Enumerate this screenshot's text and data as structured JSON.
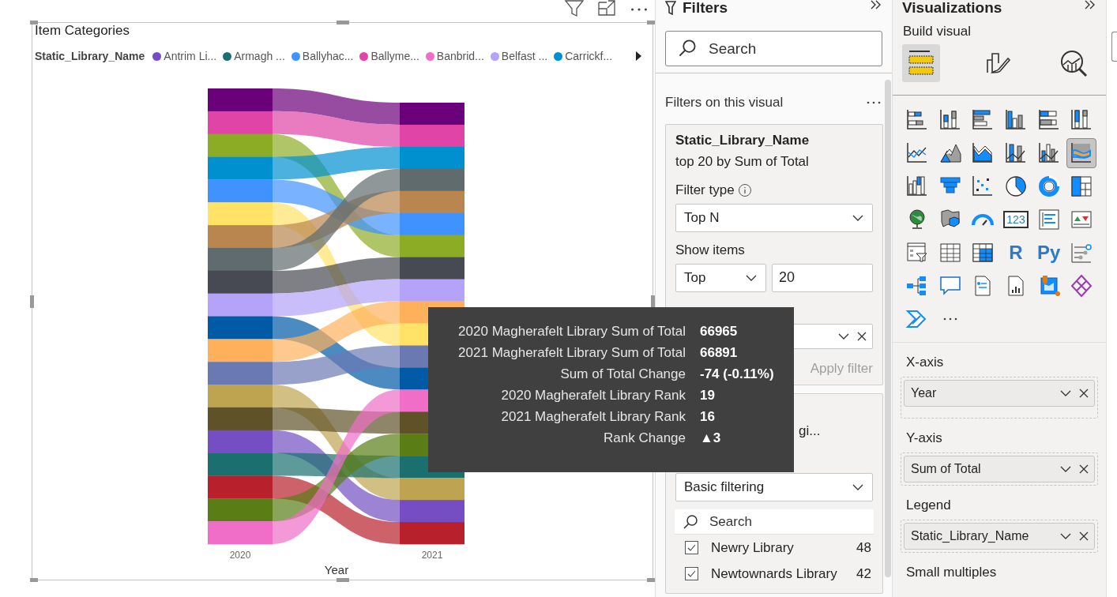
{
  "visual": {
    "title": "Item Categories",
    "legend": {
      "title": "Static_Library_Name",
      "items": [
        {
          "label": "Antrim Li...",
          "color": "#744ec2"
        },
        {
          "label": "Armagh ...",
          "color": "#1b6f6f"
        },
        {
          "label": "Ballyhac...",
          "color": "#4092ff"
        },
        {
          "label": "Ballyme...",
          "color": "#e044a7"
        },
        {
          "label": "Banbrid...",
          "color": "#f06ec8"
        },
        {
          "label": "Belfast ...",
          "color": "#b4a3f8"
        },
        {
          "label": "Carrickf...",
          "color": "#0090d0"
        }
      ]
    },
    "x_ticks": [
      "2020",
      "2021"
    ],
    "x_title": "Year"
  },
  "tooltip": {
    "rows": [
      {
        "label": "2020 Magherafelt Library Sum of Total",
        "value": "66965"
      },
      {
        "label": "2021 Magherafelt Library Sum of Total",
        "value": "66891"
      },
      {
        "label": "Sum of Total Change",
        "value": "-74 (-0.11%)"
      },
      {
        "label": "2020 Magherafelt Library Rank",
        "value": "19"
      },
      {
        "label": "2021 Magherafelt Library Rank",
        "value": "16"
      },
      {
        "label": "Rank Change",
        "value": "▲3"
      }
    ]
  },
  "filters": {
    "title": "Filters",
    "search": {
      "placeholder": "Search"
    },
    "section": "Filters on this visual",
    "cards": [
      {
        "kind": "top_n",
        "field": "Static_Library_Name",
        "summary": "top 20 by Sum of Total",
        "filter_type_label": "Filter type",
        "filter_type": "Top N",
        "show_items_label": "Show items",
        "show_items": "Top",
        "count": "20",
        "apply": {
          "label": "Apply filter",
          "disabled": true
        }
      },
      {
        "kind": "basic",
        "summary": "gi...",
        "filter_type": "Basic filtering",
        "search_placeholder": "Search",
        "items": [
          {
            "label": "Newry Library",
            "count": "48",
            "checked": true
          },
          {
            "label": "Newtownards Library",
            "count": "42",
            "checked": true
          }
        ]
      }
    ]
  },
  "visualizations": {
    "title": "Visualizations",
    "build_label": "Build visual",
    "modes": [
      {
        "kind": "build",
        "selected": true
      },
      {
        "kind": "format",
        "selected": false
      },
      {
        "kind": "analytics",
        "selected": false
      }
    ],
    "visual_types": [
      {
        "kind": "stacked-bar",
        "selected": false
      },
      {
        "kind": "stacked-column",
        "selected": false
      },
      {
        "kind": "clustered-bar",
        "selected": false
      },
      {
        "kind": "clustered-column",
        "selected": false
      },
      {
        "kind": "percent-bar",
        "selected": false
      },
      {
        "kind": "percent-column",
        "selected": false
      },
      {
        "kind": "line",
        "selected": false
      },
      {
        "kind": "area",
        "selected": false
      },
      {
        "kind": "stacked-area",
        "selected": false
      },
      {
        "kind": "line-column",
        "selected": false
      },
      {
        "kind": "line-clustered",
        "selected": false
      },
      {
        "kind": "ribbon",
        "selected": true
      },
      {
        "kind": "waterfall",
        "selected": false
      },
      {
        "kind": "funnel",
        "selected": false
      },
      {
        "kind": "scatter",
        "selected": false
      },
      {
        "kind": "pie",
        "selected": false
      },
      {
        "kind": "donut",
        "selected": false
      },
      {
        "kind": "treemap",
        "selected": false
      },
      {
        "kind": "globe",
        "selected": false
      },
      {
        "kind": "filled-map",
        "selected": false
      },
      {
        "kind": "gauge",
        "selected": false
      },
      {
        "kind": "card",
        "label": "123",
        "selected": false
      },
      {
        "kind": "multirow-card",
        "selected": false
      },
      {
        "kind": "kpi",
        "selected": false
      },
      {
        "kind": "slicer",
        "selected": false
      },
      {
        "kind": "table",
        "selected": false
      },
      {
        "kind": "matrix",
        "selected": false
      },
      {
        "kind": "text",
        "label": "R",
        "selected": false
      },
      {
        "kind": "text",
        "label": "Py",
        "selected": false
      },
      {
        "kind": "key-influencers",
        "selected": false
      },
      {
        "kind": "decomposition-tree",
        "selected": false
      },
      {
        "kind": "qa",
        "selected": false
      },
      {
        "kind": "narrative",
        "selected": false
      },
      {
        "kind": "paginated",
        "selected": false
      },
      {
        "kind": "azure-map",
        "selected": false
      },
      {
        "kind": "power-apps",
        "selected": false
      },
      {
        "kind": "power-automate",
        "selected": false
      },
      {
        "kind": "more",
        "selected": false
      }
    ],
    "wells": [
      {
        "label": "X-axis",
        "field": "Year"
      },
      {
        "label": "Y-axis",
        "field": "Sum of Total"
      },
      {
        "label": "Legend",
        "field": "Static_Library_Name"
      },
      {
        "label": "Small multiples"
      }
    ]
  }
}
